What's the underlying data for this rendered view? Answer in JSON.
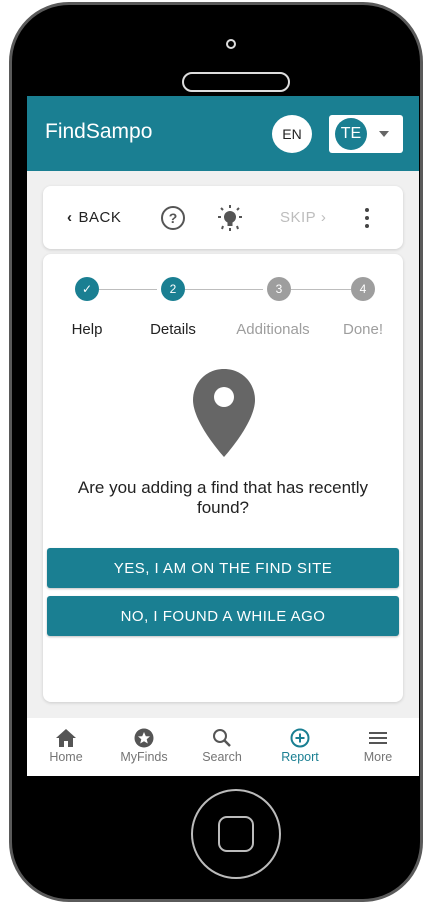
{
  "app": {
    "title": "FindSampo"
  },
  "header": {
    "lang_label": "EN",
    "user_initials": "TE"
  },
  "toolbar": {
    "back_label": "BACK",
    "skip_label": "SKIP",
    "icons": [
      "help-icon",
      "lightbulb-icon",
      "more-vert-icon"
    ]
  },
  "stepper": {
    "steps": [
      {
        "number": "✓",
        "label": "Help",
        "state": "done"
      },
      {
        "number": "2",
        "label": "Details",
        "state": "active"
      },
      {
        "number": "3",
        "label": "Additionals",
        "state": "inactive"
      },
      {
        "number": "4",
        "label": "Done!",
        "state": "inactive"
      }
    ]
  },
  "main": {
    "icon": "location-pin-icon",
    "question": "Are you adding a find that has recently found?",
    "yes_button": "YES, I AM ON THE FIND SITE",
    "no_button": "NO, I FOUND A WHILE AGO"
  },
  "nav": {
    "items": [
      {
        "label": "Home",
        "icon": "home-icon"
      },
      {
        "label": "MyFinds",
        "icon": "star-circle-icon"
      },
      {
        "label": "Search",
        "icon": "search-icon"
      },
      {
        "label": "Report",
        "icon": "add-circle-icon",
        "active": true
      },
      {
        "label": "More",
        "icon": "menu-icon"
      }
    ]
  },
  "colors": {
    "primary": "#1a7f92",
    "inactive": "#9e9e9e",
    "background": "#f0f0f0"
  }
}
